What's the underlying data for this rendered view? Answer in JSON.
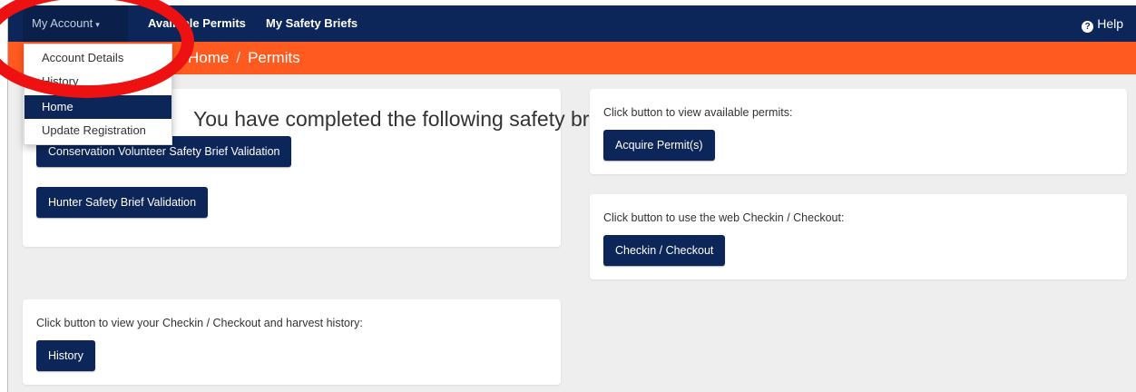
{
  "nav": {
    "account_label": "My Account",
    "permits_label": "Available Permits",
    "briefs_label": "My Safety Briefs",
    "help_label": "Help"
  },
  "breadcrumb": [
    "Home",
    "Permits"
  ],
  "account_menu": {
    "items": [
      "Account Details",
      "History",
      "Home",
      "Update Registration"
    ],
    "active_item": "Home"
  },
  "briefs_panel": {
    "heading": "You have completed the following safety briefs:",
    "buttons": [
      "Conservation Volunteer Safety Brief Validation",
      "Hunter Safety Brief Validation"
    ]
  },
  "permits_panel": {
    "text": "Click button to view available permits:",
    "button": "Acquire Permit(s)"
  },
  "checkin_panel": {
    "text": "Click button to use the web Checkin / Checkout:",
    "button": "Checkin / Checkout"
  },
  "history_panel": {
    "text": "Click button to view your Checkin / Checkout and harvest history:",
    "button": "History"
  },
  "colors": {
    "navbar": "#0c2659",
    "breadcrumb_bar": "#ff5a1f",
    "button": "#0c2659",
    "annotation_circle": "#ee1111"
  },
  "icons": {
    "help": "question-circle-icon",
    "dropdown": "caret-down-icon"
  }
}
